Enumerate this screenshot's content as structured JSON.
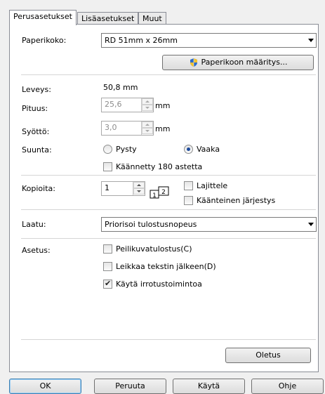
{
  "tabs": [
    {
      "label": "Perusasetukset",
      "active": true
    },
    {
      "label": "Lisäasetukset",
      "active": false
    },
    {
      "label": "Muut",
      "active": false
    }
  ],
  "paper": {
    "label": "Paperikoko:",
    "value": "RD 51mm x 26mm",
    "define_button": "Paperikoon määritys..."
  },
  "dims": {
    "width_label": "Leveys:",
    "width_value": "50,8 mm",
    "length_label": "Pituus:",
    "length_value": "25,6",
    "length_unit": "mm",
    "feed_label": "Syöttö:",
    "feed_value": "3,0",
    "feed_unit": "mm"
  },
  "orientation": {
    "label": "Suunta:",
    "portrait": "Pysty",
    "landscape": "Vaaka",
    "selected": "Vaaka",
    "rotate_180": "Käännetty 180 astetta",
    "rotate_checked": false
  },
  "copies": {
    "label": "Kopioita:",
    "value": "1",
    "collate": "Lajittele",
    "collate_checked": false,
    "reverse": "Käänteinen järjestys",
    "reverse_checked": false,
    "icon_numbers": [
      "1",
      "2"
    ]
  },
  "quality": {
    "label": "Laatu:",
    "value": "Priorisoi tulostusnopeus"
  },
  "options": {
    "label": "Asetus:",
    "mirror": "Peilikuvatulostus(C)",
    "mirror_checked": false,
    "cut_after_text": "Leikkaa tekstin jälkeen(D)",
    "cut_after_text_checked": false,
    "tear_off": "Käytä irrotustoimintoa",
    "tear_off_checked": true
  },
  "default_button": "Oletus",
  "footer": {
    "ok": "OK",
    "cancel": "Peruuta",
    "apply": "Käytä",
    "help": "Ohje"
  },
  "colors": {
    "panel": "#ffffff",
    "window": "#f0f0f0",
    "radio_dot": "#1c4a9c"
  }
}
